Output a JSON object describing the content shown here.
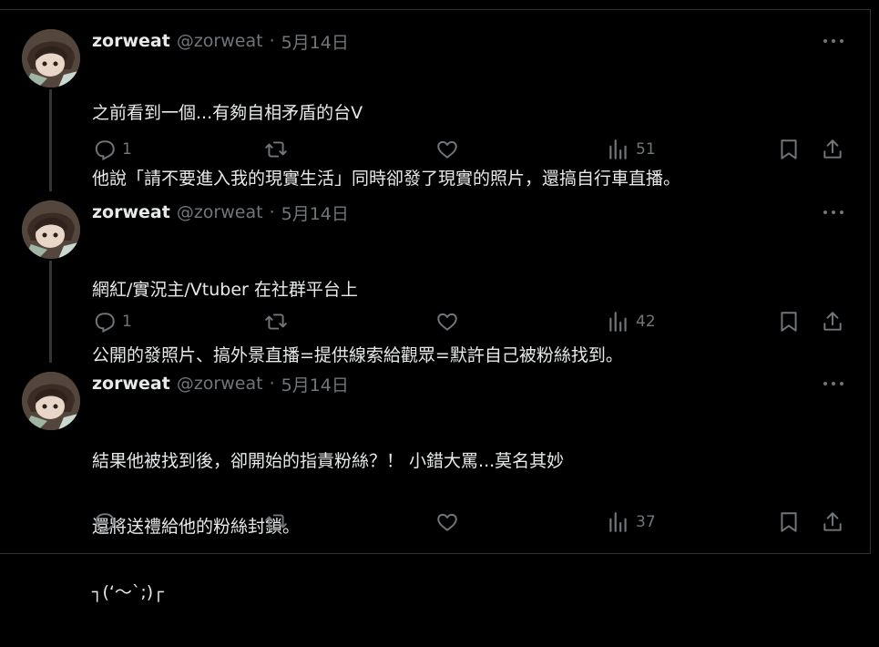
{
  "tweets": [
    {
      "display_name": "zorweat",
      "handle": "@zorweat",
      "separator": "·",
      "date": "5月14日",
      "lines": [
        "之前看到一個...有夠自相矛盾的台V",
        "他說「請不要進入我的現實生活」同時卻發了現實的照片，還搞自行車直播。"
      ],
      "replies": "1",
      "views": "51"
    },
    {
      "display_name": "zorweat",
      "handle": "@zorweat",
      "separator": "·",
      "date": "5月14日",
      "lines": [
        "網紅/實況主/Vtuber 在社群平台上",
        "公開的發照片、搞外景直播=提供線索給觀眾=默許自己被粉絲找到。"
      ],
      "replies": "1",
      "views": "42"
    },
    {
      "display_name": "zorweat",
      "handle": "@zorweat",
      "separator": "·",
      "date": "5月14日",
      "lines": [
        "結果他被找到後，卻開始的指責粉絲？！ 小錯大罵...莫名其妙",
        "還將送禮給他的粉絲封鎖。",
        "┐(‘～`;)┌"
      ],
      "replies": "",
      "views": "37"
    }
  ],
  "icons": {
    "reply": "reply-icon",
    "retweet": "retweet-icon",
    "like": "heart-icon",
    "views": "views-icon",
    "bookmark": "bookmark-icon",
    "share": "share-icon",
    "more": "more-icon"
  },
  "colors": {
    "background": "#000000",
    "text": "#e7e9ea",
    "muted": "#71767b",
    "divider": "#2f3336"
  }
}
